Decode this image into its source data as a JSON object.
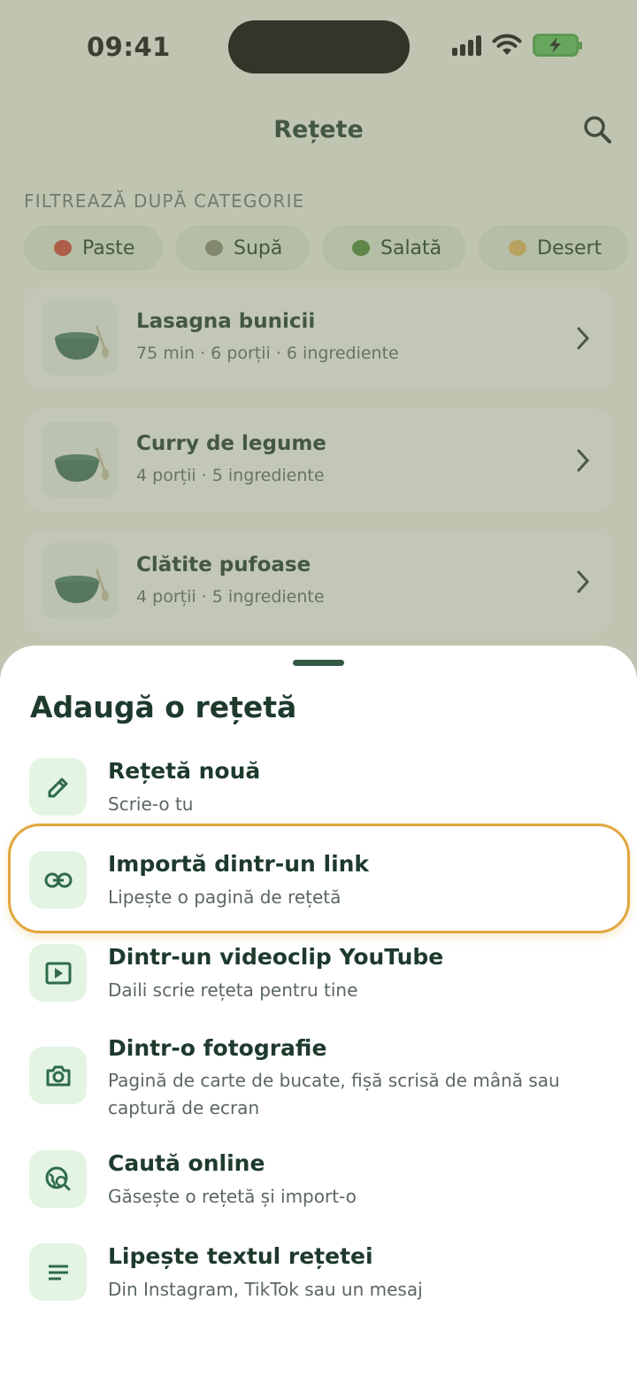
{
  "status_bar": {
    "time": "09:41"
  },
  "header": {
    "title": "Rețete"
  },
  "filter": {
    "label": "FILTREAZĂ DUPĂ CATEGORIE",
    "chips": [
      {
        "label": "Paste",
        "icon": "tomato-icon",
        "color": "#d2453a"
      },
      {
        "label": "Supă",
        "icon": "soup-bowl-icon",
        "color": "#8a8f7a"
      },
      {
        "label": "Salată",
        "icon": "salad-icon",
        "color": "#4f8a3a"
      },
      {
        "label": "Desert",
        "icon": "cake-icon",
        "color": "#e8b860"
      }
    ]
  },
  "recipes": [
    {
      "name": "Lasagna bunicii",
      "meta": "75 min · 6 porții · 6 ingrediente"
    },
    {
      "name": "Curry de legume",
      "meta": "4 porții · 5 ingrediente"
    },
    {
      "name": "Clătite pufoase",
      "meta": "4 porții · 5 ingrediente"
    }
  ],
  "sheet": {
    "title": "Adaugă o rețetă",
    "options": [
      {
        "title": "Rețetă nouă",
        "subtitle": "Scrie-o tu",
        "icon": "pencil-icon"
      },
      {
        "title": "Importă dintr-un link",
        "subtitle": "Lipește o pagină de rețetă",
        "icon": "link-icon"
      },
      {
        "title": "Dintr-un videoclip YouTube",
        "subtitle": "Daili scrie rețeta pentru tine",
        "icon": "play-icon"
      },
      {
        "title": "Dintr-o fotografie",
        "subtitle": "Pagină de carte de bucate, fișă scrisă de mână sau captură de ecran",
        "icon": "camera-icon"
      },
      {
        "title": "Caută online",
        "subtitle": "Găsește o rețetă și import-o",
        "icon": "globe-search-icon"
      },
      {
        "title": "Lipește textul rețetei",
        "subtitle": "Din Instagram, TikTok sau un mesaj",
        "icon": "text-lines-icon"
      }
    ]
  },
  "colors": {
    "accent": "#2f6b4a",
    "highlight": "#e0a63c"
  }
}
